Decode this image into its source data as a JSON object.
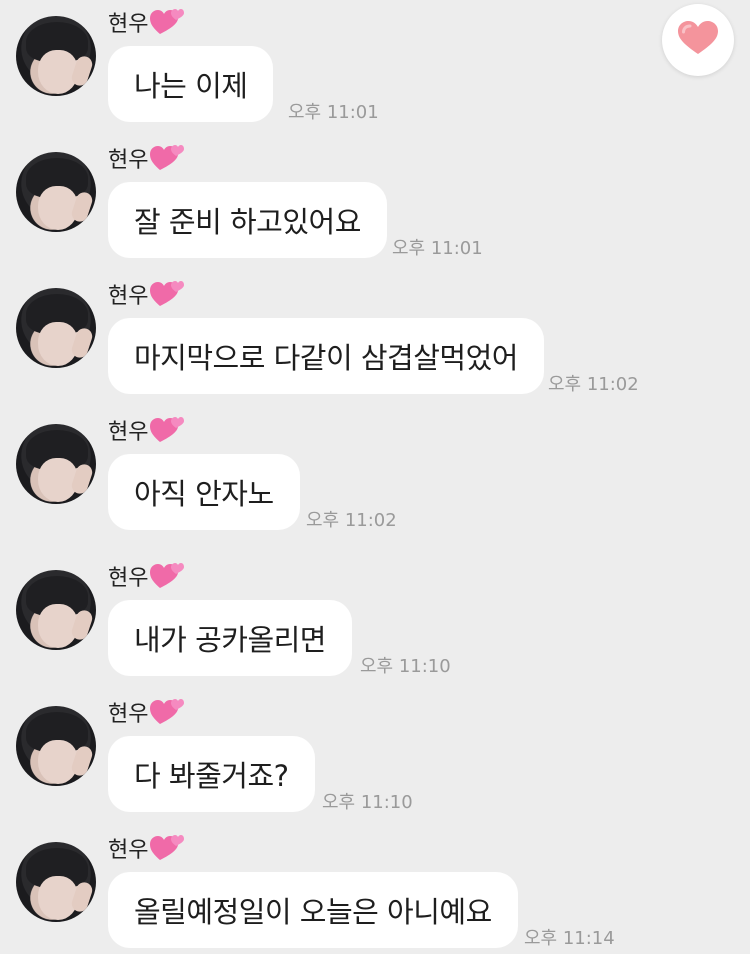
{
  "colors": {
    "background": "#ededed",
    "bubble": "#ffffff",
    "timestamp": "#9a9a9a",
    "heart_pink": "#f06aa8",
    "fab_heart": "#f4949c"
  },
  "fab": {
    "icon": "heart-icon"
  },
  "messages": [
    {
      "sender": "현우",
      "sender_icon": "two-hearts-icon",
      "text": "나는 이제",
      "time": "오후 11:01"
    },
    {
      "sender": "현우",
      "sender_icon": "two-hearts-icon",
      "text": "잘 준비 하고있어요",
      "time": "오후 11:01"
    },
    {
      "sender": "현우",
      "sender_icon": "two-hearts-icon",
      "text": "마지막으로 다같이 삼겹살먹었어",
      "time": "오후 11:02"
    },
    {
      "sender": "현우",
      "sender_icon": "two-hearts-icon",
      "text": "아직 안자노",
      "time": "오후 11:02"
    },
    {
      "sender": "현우",
      "sender_icon": "two-hearts-icon",
      "text": "내가 공카올리면",
      "time": "오후 11:10"
    },
    {
      "sender": "현우",
      "sender_icon": "two-hearts-icon",
      "text": "다 봐줄거죠?",
      "time": "오후 11:10"
    },
    {
      "sender": "현우",
      "sender_icon": "two-hearts-icon",
      "text": "올릴예정일이 오늘은 아니예요",
      "time": "오후 11:14"
    }
  ]
}
